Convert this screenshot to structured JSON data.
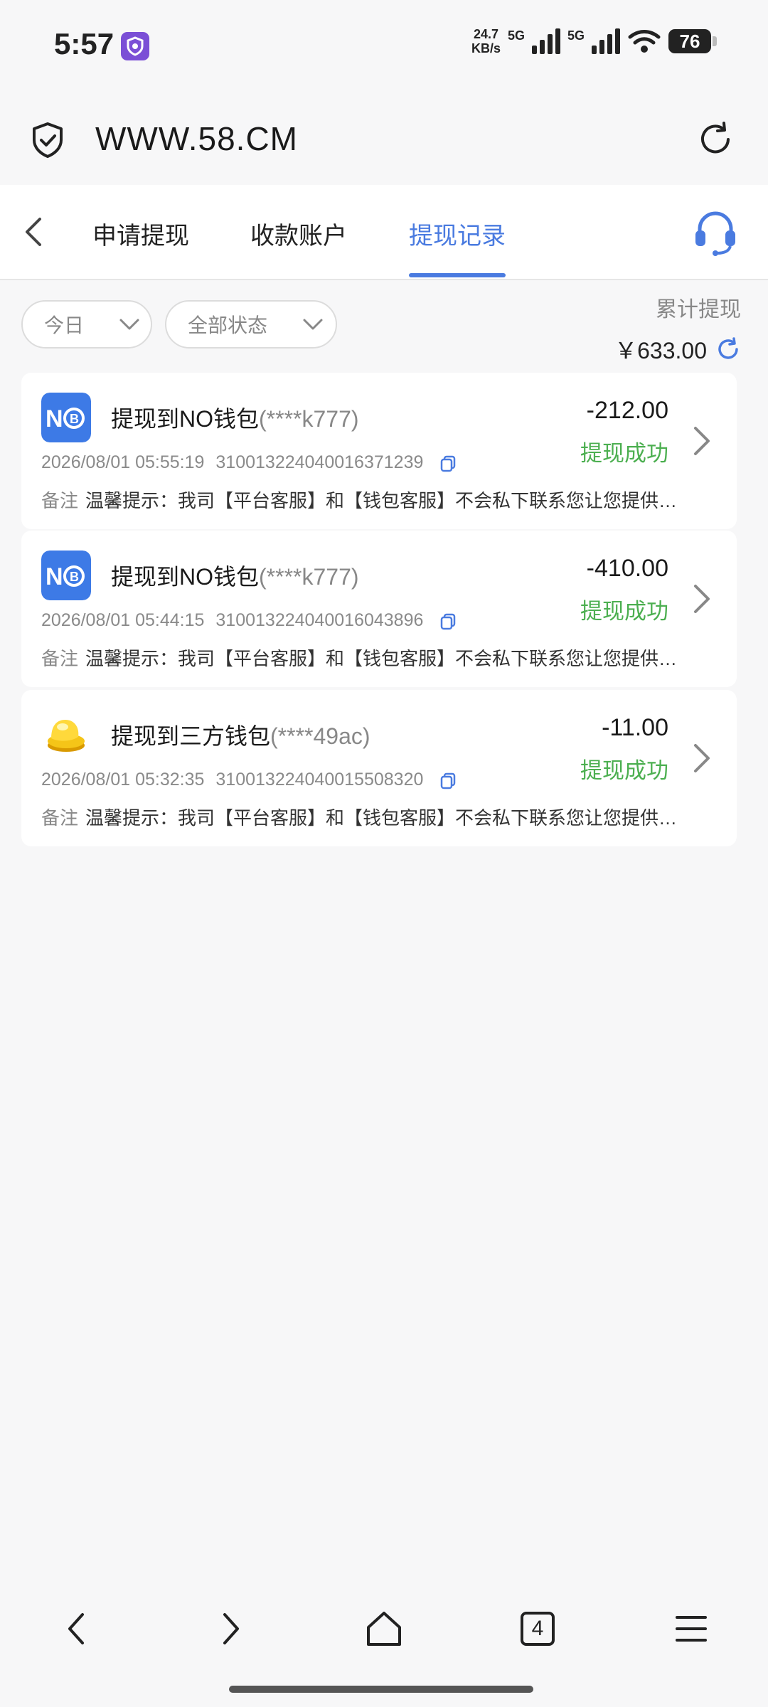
{
  "status_bar": {
    "time": "5:57",
    "speed_value": "24.7",
    "speed_unit": "KB/s",
    "net1": "5G",
    "net2": "5G",
    "battery": "76"
  },
  "browser": {
    "url": "WWW.58.CM"
  },
  "header": {
    "tabs": [
      "申请提现",
      "收款账户",
      "提现记录"
    ],
    "active_tab": 2
  },
  "filters": {
    "date": "今日",
    "status": "全部状态"
  },
  "summary": {
    "label": "累计提现",
    "value": "￥633.00"
  },
  "records": [
    {
      "title": "提现到NO钱包",
      "masked": "(****k777)",
      "datetime": "2026/08/01 05:55:19",
      "order_no": "310013224040016371239",
      "amount": "-212.00",
      "status": "提现成功",
      "note_label": "备注",
      "note": "温馨提示：我司【平台客服】和【钱包客服】不会私下联系您让您提供任何信息",
      "logo": "no-wallet-icon"
    },
    {
      "title": "提现到NO钱包",
      "masked": "(****k777)",
      "datetime": "2026/08/01 05:44:15",
      "order_no": "310013224040016043896",
      "amount": "-410.00",
      "status": "提现成功",
      "note_label": "备注",
      "note": "温馨提示：我司【平台客服】和【钱包客服】不会私下联系您让您提供任何信息",
      "logo": "no-wallet-icon"
    },
    {
      "title": "提现到三方钱包",
      "masked": "(****49ac)",
      "datetime": "2026/08/01 05:32:35",
      "order_no": "310013224040015508320",
      "amount": "-11.00",
      "status": "提现成功",
      "note_label": "备注",
      "note": "温馨提示：我司【平台客服】和【钱包客服】不会私下联系您让您提供任何信息",
      "logo": "third-party-wallet-icon"
    }
  ],
  "bottom_nav": {
    "tab_count": "4"
  },
  "colors": {
    "accent": "#4a7be0",
    "success": "#4caf50",
    "background": "#f7f7f8"
  }
}
